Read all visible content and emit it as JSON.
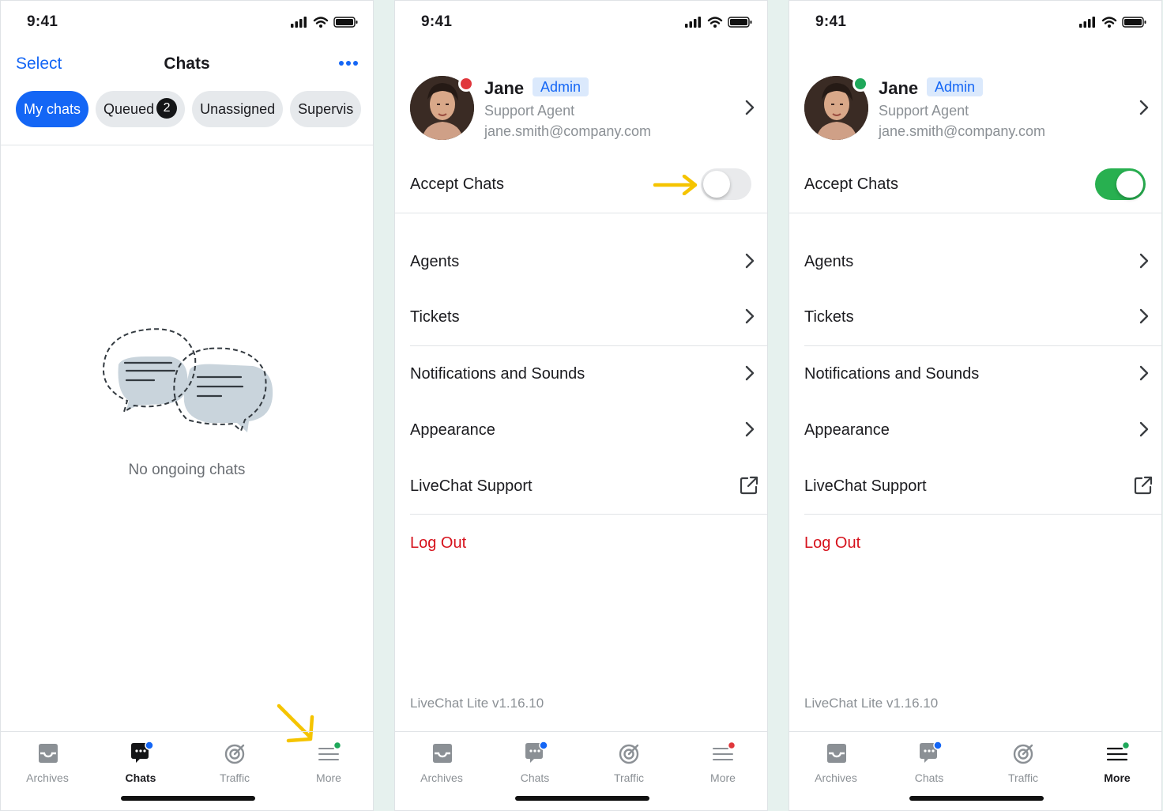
{
  "status_bar": {
    "time": "9:41"
  },
  "chats_screen": {
    "nav_left": "Select",
    "title": "Chats",
    "filters": [
      {
        "label": "My chats",
        "active": true
      },
      {
        "label": "Queued",
        "count": "2"
      },
      {
        "label": "Unassigned"
      },
      {
        "label": "Supervis"
      }
    ],
    "empty_text": "No ongoing chats"
  },
  "profile": {
    "name": "Jane",
    "role_badge": "Admin",
    "title": "Support Agent",
    "email": "jane.smith@company.com"
  },
  "accept_chats_label": "Accept Chats",
  "screens": [
    {
      "status_dot_color": "#e0373c",
      "accept_chats_on": false
    },
    {
      "status_dot_color": "#1fa85a",
      "accept_chats_on": true
    }
  ],
  "menu_items": [
    {
      "label": "Agents",
      "icon": "chevron-right-icon"
    },
    {
      "label": "Tickets",
      "icon": "chevron-right-icon"
    },
    {
      "label": "Notifications and Sounds",
      "icon": "chevron-right-icon"
    },
    {
      "label": "Appearance",
      "icon": "chevron-right-icon"
    },
    {
      "label": "LiveChat Support",
      "icon": "external-link-icon"
    }
  ],
  "logout_label": "Log Out",
  "version": "LiveChat Lite v1.16.10",
  "tabs": [
    {
      "label": "Archives",
      "icon": "archive-icon"
    },
    {
      "label": "Chats",
      "icon": "chats-icon"
    },
    {
      "label": "Traffic",
      "icon": "traffic-target-icon"
    },
    {
      "label": "More",
      "icon": "more-menu-icon"
    }
  ],
  "colors": {
    "accent": "#1466f5",
    "logout": "#d6121c",
    "toggle_on": "#28b050",
    "annotation_arrow": "#f5c400",
    "status_away": "#e0373c",
    "status_online": "#1fa85a"
  }
}
